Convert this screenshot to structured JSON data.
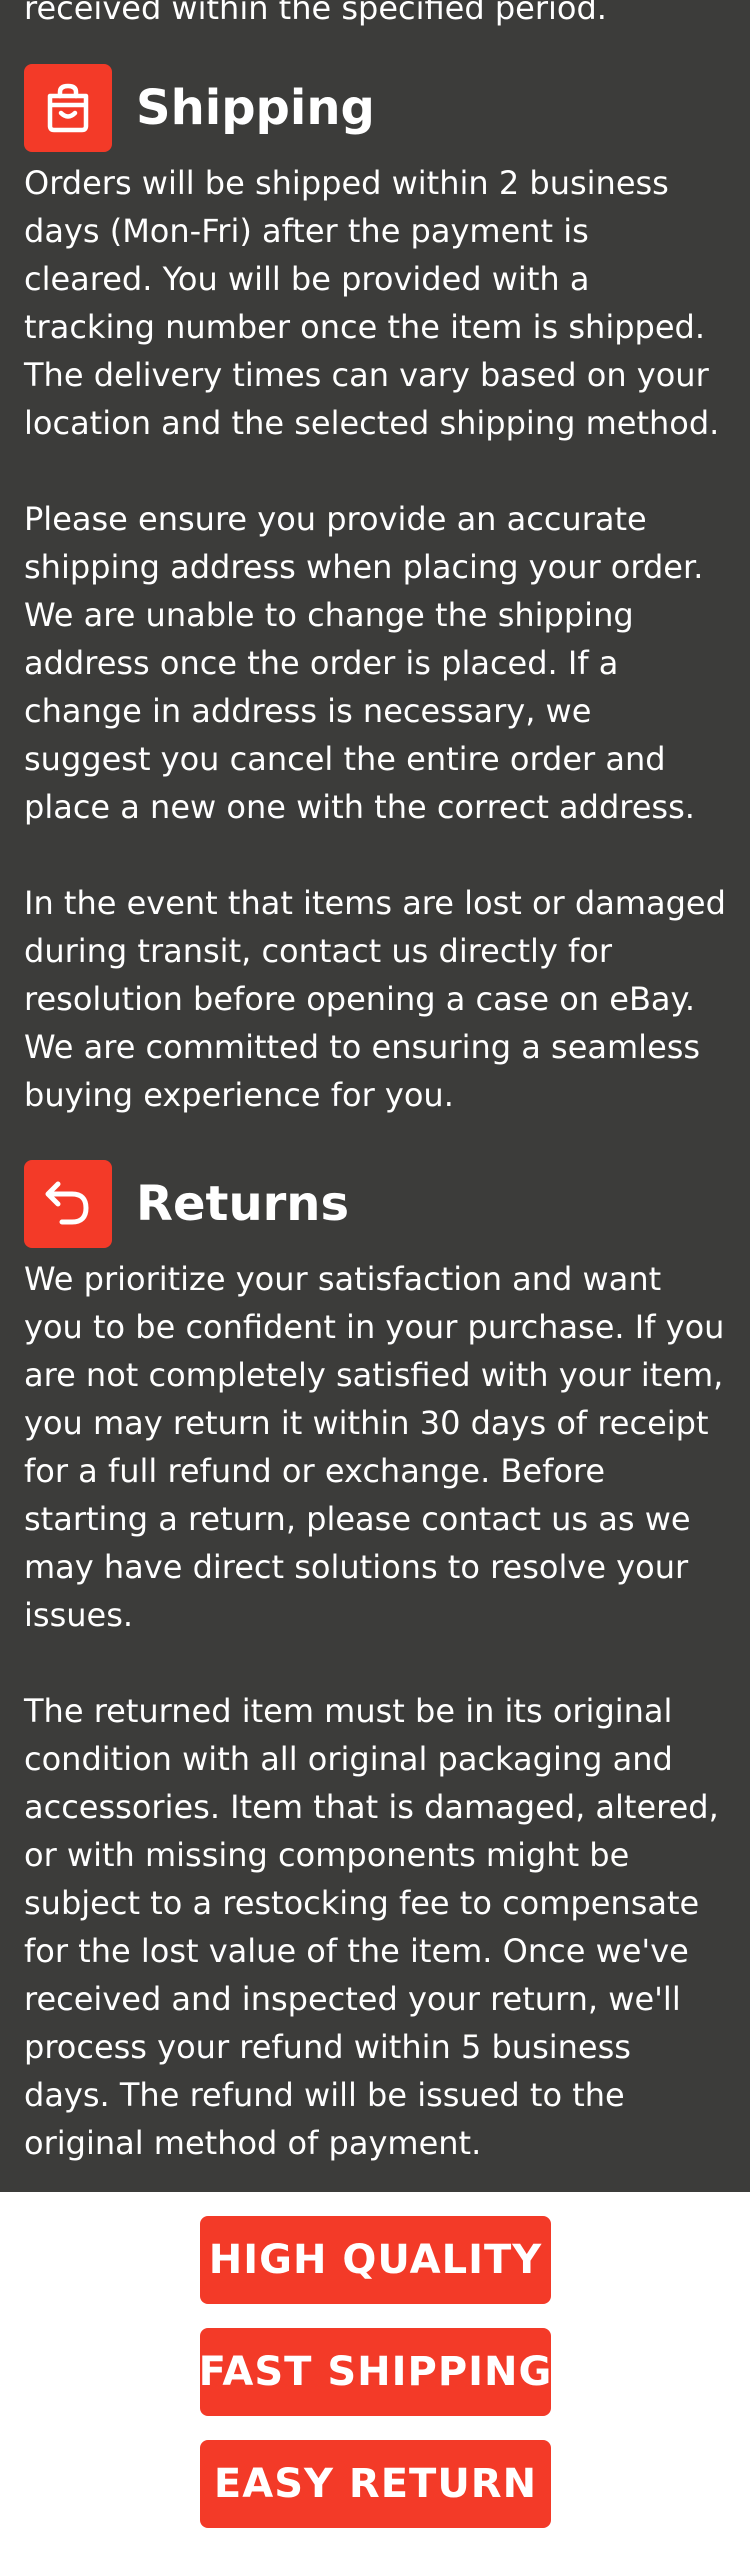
{
  "colors": {
    "background_dark": "#3c3c3a",
    "accent": "#f33a28",
    "text": "#ffffff",
    "footer_background": "#ffffff"
  },
  "intro_cutoff": "received within the specified period.",
  "shipping": {
    "icon": "shopping-bag-icon",
    "title": "Shipping",
    "paragraphs": [
      "Orders will be shipped within 2 business\ndays (Mon-Fri) after the payment is\ncleared. You will be provided with a\ntracking number once the item is shipped.\nThe delivery times can vary based on your\nlocation and the selected shipping method.",
      "Please ensure you provide an accurate\nshipping address when placing your order.\nWe are unable to change the shipping\naddress once the order is placed. If a\nchange in address is necessary, we\nsuggest you cancel the entire order and\nplace a new one with the correct address.",
      "In the event that items are lost or damaged\nduring transit, contact us directly for\nresolution before opening a case on eBay.\nWe are committed to ensuring a seamless\nbuying experience for you."
    ]
  },
  "returns": {
    "icon": "return-arrow-icon",
    "title": "Returns",
    "paragraphs": [
      "We prioritize your satisfaction and want\nyou to be confident in your purchase. If you\nare not completely satisfied with your item,\nyou may return it within 30 days of receipt\nfor a full refund or exchange. Before\nstarting a return, please contact us as we\nmay have direct solutions to resolve your\nissues.",
      "The returned item must be in its original\ncondition with all original packaging and\naccessories. Item that is damaged, altered,\nor with missing components might be\nsubject to a restocking fee to compensate\nfor the lost value of the item. Once we've\nreceived and inspected your return, we'll\nprocess your refund within 5 business\ndays. The refund will be issued to the\noriginal method of payment."
    ]
  },
  "badges": [
    "HIGH QUALITY",
    "FAST SHIPPING",
    "EASY RETURN"
  ]
}
